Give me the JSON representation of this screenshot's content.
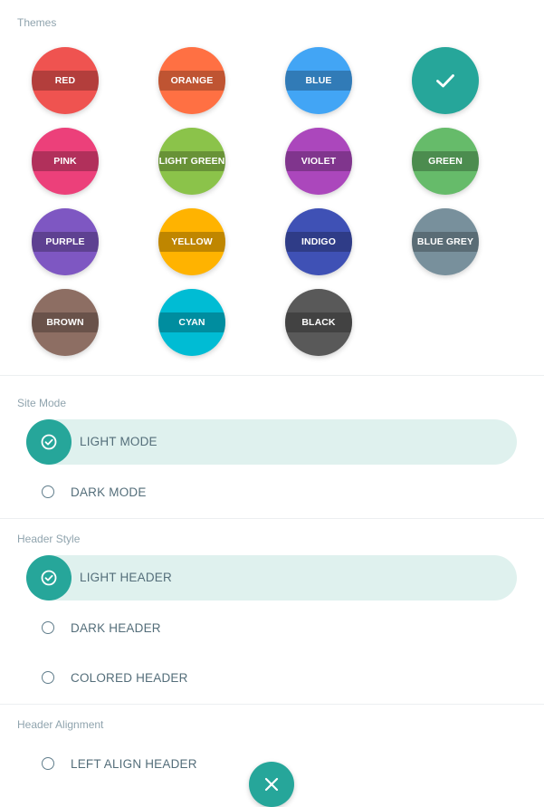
{
  "themes": {
    "label": "Themes",
    "items": [
      {
        "name": "RED",
        "color": "#ef5350"
      },
      {
        "name": "ORANGE",
        "color": "#ff7043"
      },
      {
        "name": "BLUE",
        "color": "#42a5f5"
      },
      {
        "name": "",
        "color": "#26a69a",
        "selected": true
      },
      {
        "name": "PINK",
        "color": "#ec407a"
      },
      {
        "name": "LIGHT GREEN",
        "color": "#8bc34a"
      },
      {
        "name": "VIOLET",
        "color": "#ab47bc"
      },
      {
        "name": "GREEN",
        "color": "#66bb6a"
      },
      {
        "name": "PURPLE",
        "color": "#7e57c2"
      },
      {
        "name": "YELLOW",
        "color": "#ffb300"
      },
      {
        "name": "INDIGO",
        "color": "#3f51b5"
      },
      {
        "name": "BLUE GREY",
        "color": "#78909c"
      },
      {
        "name": "BROWN",
        "color": "#8d6e63"
      },
      {
        "name": "CYAN",
        "color": "#00bcd4"
      },
      {
        "name": "BLACK",
        "color": "#595959"
      }
    ]
  },
  "site_mode": {
    "label": "Site Mode",
    "options": [
      "LIGHT MODE",
      "DARK MODE"
    ],
    "selected": "LIGHT MODE"
  },
  "header_style": {
    "label": "Header Style",
    "options": [
      "LIGHT HEADER",
      "DARK HEADER",
      "COLORED HEADER"
    ],
    "selected": "LIGHT HEADER"
  },
  "header_alignment": {
    "label": "Header Alignment",
    "options": [
      "LEFT ALIGN HEADER"
    ]
  },
  "colors": {
    "accent": "#26a69a",
    "accent_light": "#dff1ee"
  }
}
